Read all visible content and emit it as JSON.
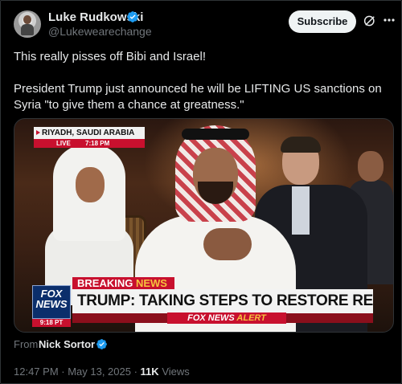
{
  "author": {
    "name": "Luke Rudkowski",
    "handle": "@Lukewearechange",
    "verified_icon": "verified-badge-icon"
  },
  "header": {
    "subscribe_label": "Subscribe",
    "grok_icon": "grok-icon",
    "more_icon": "more-options-icon"
  },
  "post": {
    "paragraph_1": "This really pisses off Bibi and Israel!",
    "paragraph_2": "President Trump just announced he will be LIFTING US sanctions on Syria \"to give them a chance at greatness.\""
  },
  "media": {
    "location": "RIYADH, SAUDI ARABIA",
    "live_label": "LIVE",
    "live_time": "7:18 PM",
    "breaking_word": "BREAKING",
    "news_word": "NEWS",
    "headline": "TRUMP: TAKING STEPS TO RESTORE RELATIONS W/SYRIA",
    "alert_brand": "FOX NEWS",
    "alert_word": "ALERT",
    "logo_line1": "FOX",
    "logo_line2": "NEWS",
    "logo_time": "9:18 PT"
  },
  "footer": {
    "from_label": "From",
    "from_name": "Nick Sortor",
    "timestamp": "12:47 PM · May 13, 2025 ·",
    "views_count": "11K",
    "views_label": "Views"
  },
  "colors": {
    "background": "#000000",
    "verified_blue": "#1d9bf0",
    "fox_red": "#c8102e",
    "fox_blue": "#0b2e6b"
  }
}
